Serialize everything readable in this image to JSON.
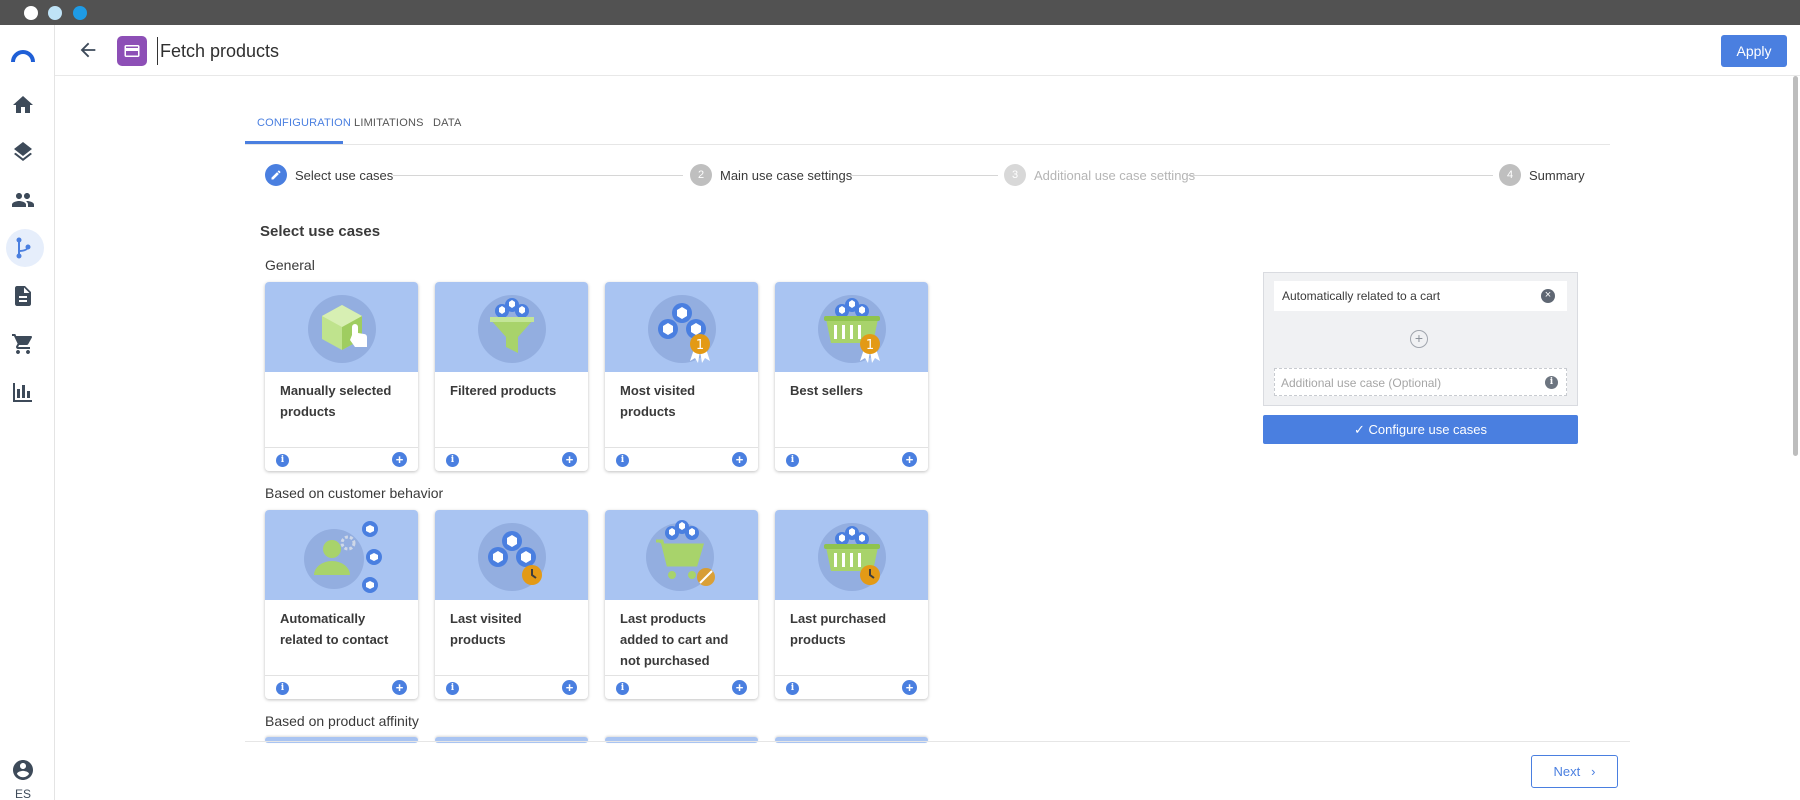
{
  "header": {
    "title": "Fetch products",
    "apply_label": "Apply"
  },
  "sidebar": {
    "items": [
      {
        "icon": "logo-icon"
      },
      {
        "icon": "home-icon"
      },
      {
        "icon": "layers-icon"
      },
      {
        "icon": "people-icon"
      },
      {
        "icon": "workflow-icon",
        "active": true
      },
      {
        "icon": "document-icon"
      },
      {
        "icon": "cart-icon"
      },
      {
        "icon": "chart-icon"
      }
    ],
    "user_lang": "ES"
  },
  "tabs": [
    {
      "label": "CONFIGURATION",
      "active": true
    },
    {
      "label": "LIMITATIONS"
    },
    {
      "label": "DATA"
    }
  ],
  "stepper": [
    {
      "num": "1",
      "label": "Select use cases",
      "state": "active"
    },
    {
      "num": "2",
      "label": "Main use case settings",
      "state": "pending"
    },
    {
      "num": "3",
      "label": "Additional use case settings",
      "state": "disabled"
    },
    {
      "num": "4",
      "label": "Summary",
      "state": "pending"
    }
  ],
  "section_title": "Select use cases",
  "groups": [
    {
      "label": "General",
      "cards": [
        {
          "label": "Manually selected products",
          "icon": "manual-box-icon"
        },
        {
          "label": "Filtered products",
          "icon": "filter-funnel-icon"
        },
        {
          "label": "Most visited products",
          "icon": "most-visited-icon"
        },
        {
          "label": "Best sellers",
          "icon": "best-sellers-basket-icon"
        }
      ]
    },
    {
      "label": "Based on customer behavior",
      "cards": [
        {
          "label": "Automatically related to contact",
          "icon": "contact-related-icon"
        },
        {
          "label": "Last visited products",
          "icon": "last-visited-icon"
        },
        {
          "label": "Last products added to cart and not purchased",
          "icon": "cart-not-purchased-icon"
        },
        {
          "label": "Last purchased products",
          "icon": "last-purchased-basket-icon"
        }
      ]
    },
    {
      "label": "Based on product affinity",
      "cards": []
    }
  ],
  "use_case_panel": {
    "main_use_case": "Automatically related to a cart",
    "additional_placeholder": "Additional use case (Optional)",
    "configure_label": "Configure use cases"
  },
  "footer": {
    "next_label": "Next"
  },
  "colors": {
    "accent": "#4a7fe0",
    "card_image_bg": "#a9c4f2",
    "node_badge": "#8d4fb6",
    "medal": "#e39a16",
    "product_green": "#a8d36b"
  }
}
